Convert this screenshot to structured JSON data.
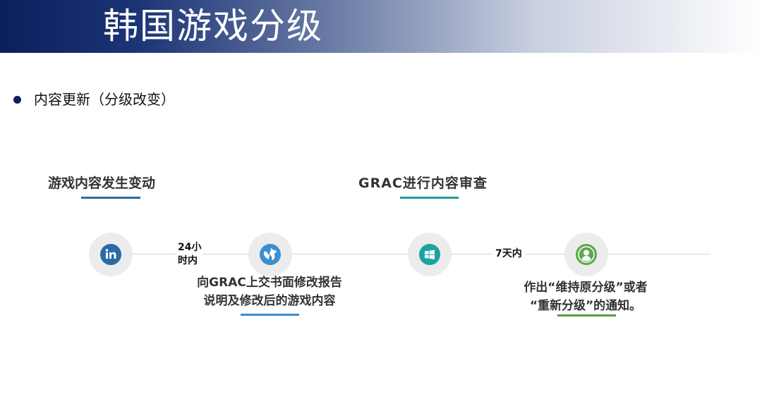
{
  "header": {
    "title": "韩国游戏分级"
  },
  "bullet": {
    "text": "内容更新（分级改变）"
  },
  "steps": {
    "left_title": "游戏内容发生变动",
    "right_title": "GRAC进行内容审查"
  },
  "timeline": {
    "note1_line1": "24小",
    "note1_line2": "时内",
    "note2": "7天内",
    "desc1_line1": "向GRAC上交书面修改报告",
    "desc1_line2": "说明及修改后的游戏内容",
    "desc2_line1": "作出“维持原分级”或者",
    "desc2_line2": "“重新分级”的通知。"
  },
  "colors": {
    "header_dark": "#0b1f5c",
    "underline_blue": "#2e6da4",
    "underline_teal": "#1e9a9a",
    "underline_lightblue": "#3a8fd0",
    "underline_green": "#5c9a4a",
    "icon_linkedin": "#2a6aa8",
    "icon_globe": "#3a8fd0",
    "icon_windows": "#1aa3a3",
    "icon_user": "#5ea84f"
  },
  "icons": [
    "linkedin-icon",
    "globe-icon",
    "windows-icon",
    "user-icon"
  ]
}
